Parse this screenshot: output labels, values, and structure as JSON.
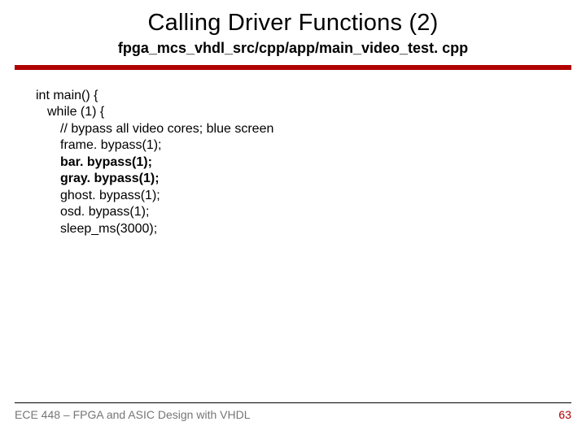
{
  "title": "Calling Driver Functions (2)",
  "subtitle": "fpga_mcs_vhdl_src/cpp/app/main_video_test. cpp",
  "code": {
    "line1": "int main() {",
    "line2": "while (1) {",
    "line3": "// bypass all video cores; blue screen",
    "line4": "frame. bypass(1);",
    "line5": "bar. bypass(1);",
    "line6": "gray. bypass(1);",
    "line7": "ghost. bypass(1);",
    "line8": "osd. bypass(1);",
    "line9": "sleep_ms(3000);"
  },
  "footer": {
    "left": "ECE 448 – FPGA and ASIC Design with VHDL",
    "page": "63"
  }
}
